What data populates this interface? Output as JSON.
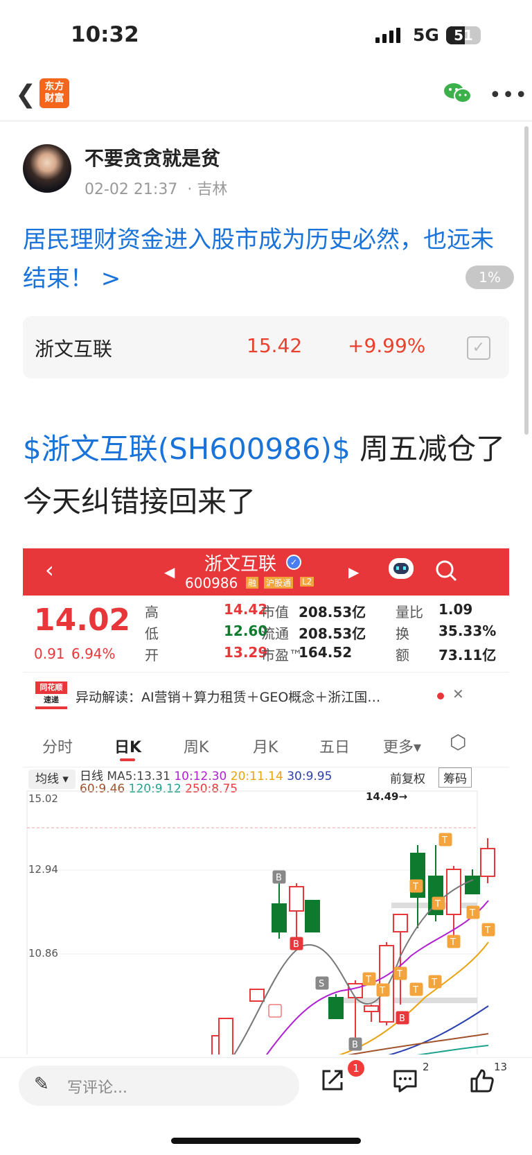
{
  "status_bar": {
    "time": "10:32",
    "network": "5G",
    "battery": "51"
  },
  "nav": {
    "logo_line1": "东方",
    "logo_line2": "财富"
  },
  "post": {
    "author": "不要贪贪就是贫",
    "date": "02-02 21:37",
    "location": "· 吉林",
    "headline": "居民理财资金进入股市成为历史必然，也远未结束！ >",
    "progress_badge": "1%",
    "stock_card": {
      "name": "浙文互联",
      "price": "15.42",
      "change": "+9.99%"
    },
    "body_tag": "$浙文互联(SH600986)$",
    "body_text": " 周五减仓了 今天纠错接回来了"
  },
  "screenshot": {
    "header": {
      "name": "浙文互联",
      "code": "600986",
      "badge1": "融",
      "badge2": "沪股通",
      "badge3": "L2"
    },
    "quote": {
      "price": "14.02",
      "change": "0.91",
      "change_pct": "6.94%",
      "rows": [
        {
          "l1": "高",
          "v1": "14.42",
          "l2": "市值",
          "v2": "208.53亿",
          "l3": "量比",
          "v3": "1.09"
        },
        {
          "l1": "低",
          "v1": "12.60",
          "l2": "流通",
          "v2": "208.53亿",
          "l3": "换",
          "v3": "35.33%"
        },
        {
          "l1": "开",
          "v1": "13.29",
          "l2": "市盈™",
          "v2": "164.52",
          "l3": "额",
          "v3": "73.11亿"
        }
      ]
    },
    "alert": {
      "logo1": "同花顺",
      "logo2": "速递",
      "text": "异动解读：AI营销＋算力租赁＋GEO概念＋浙江国…"
    },
    "tabs": [
      "分时",
      "日K",
      "周K",
      "月K",
      "五日",
      "更多▾"
    ],
    "legend": {
      "type": "均线 ▾",
      "period": "日线",
      "ma5": "MA5:13.31",
      "ma10": "10:12.30",
      "ma20": "20:11.14",
      "ma30": "30:9.95",
      "ma60": "60:9.46",
      "ma120": "120:9.12",
      "ma250": "250:8.75",
      "fuquan": "前复权",
      "chouma": "筹码"
    },
    "axis": [
      "15.02",
      "12.94",
      "10.86"
    ],
    "high_label": "14.49→"
  },
  "bottom": {
    "comment_placeholder": "写评论...",
    "share_badge": "1",
    "comment_count": "2",
    "like_count": "13"
  },
  "colors": {
    "up": "#e8373a",
    "down": "#0e7a2d",
    "link": "#1a73d9",
    "accent": "#f4661b"
  }
}
